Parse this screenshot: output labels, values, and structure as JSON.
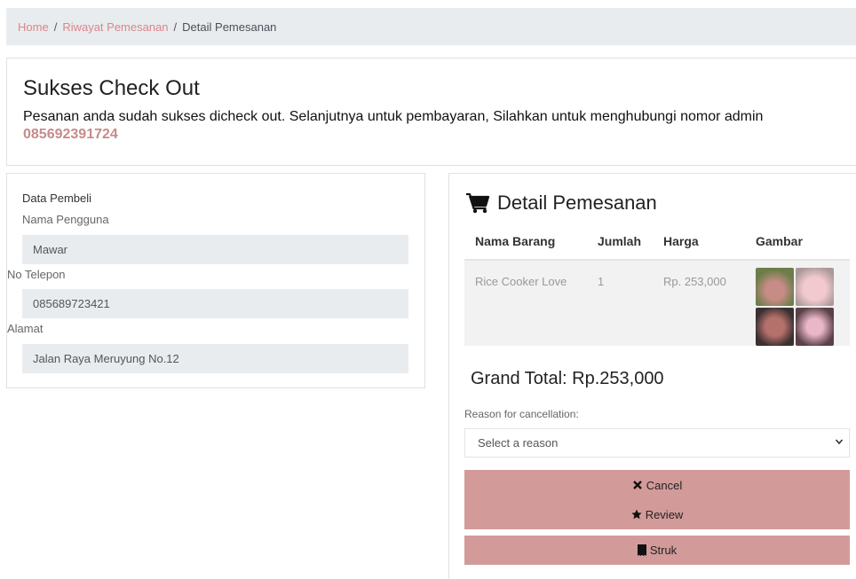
{
  "breadcrumb": {
    "home": "Home",
    "history": "Riwayat Pemesanan",
    "current": "Detail Pemesanan",
    "separator": "/"
  },
  "success": {
    "title": "Sukses Check Out",
    "message": "Pesanan anda sudah sukses dicheck out. Selanjutnya untuk pembayaran, Silahkan untuk menghubungi nomor admin",
    "admin_phone": "085692391724"
  },
  "buyer": {
    "heading": "Data Pembeli",
    "name_label": "Nama Pengguna",
    "name": "Mawar",
    "phone_label": "No Telepon",
    "phone": "085689723421",
    "address_label": "Alamat",
    "address": "Jalan Raya Meruyung No.12"
  },
  "order": {
    "title": "Detail Pemesanan",
    "icon": "cart-icon",
    "columns": [
      "Nama Barang",
      "Jumlah",
      "Harga",
      "Gambar"
    ],
    "rows": [
      {
        "name": "Rice Cooker Love",
        "qty": "1",
        "price": "Rp. 253,000"
      }
    ],
    "grand_total": "Grand Total: Rp.253,000",
    "reason_label": "Reason for cancellation:",
    "reason_placeholder": "Select a reason",
    "cancel_label": "Cancel",
    "review_label": "Review",
    "struk_label": "Struk"
  },
  "colors": {
    "accent": "#d29b9a",
    "link": "#d9868a",
    "breadcrumb_bg": "#e9ecef"
  }
}
